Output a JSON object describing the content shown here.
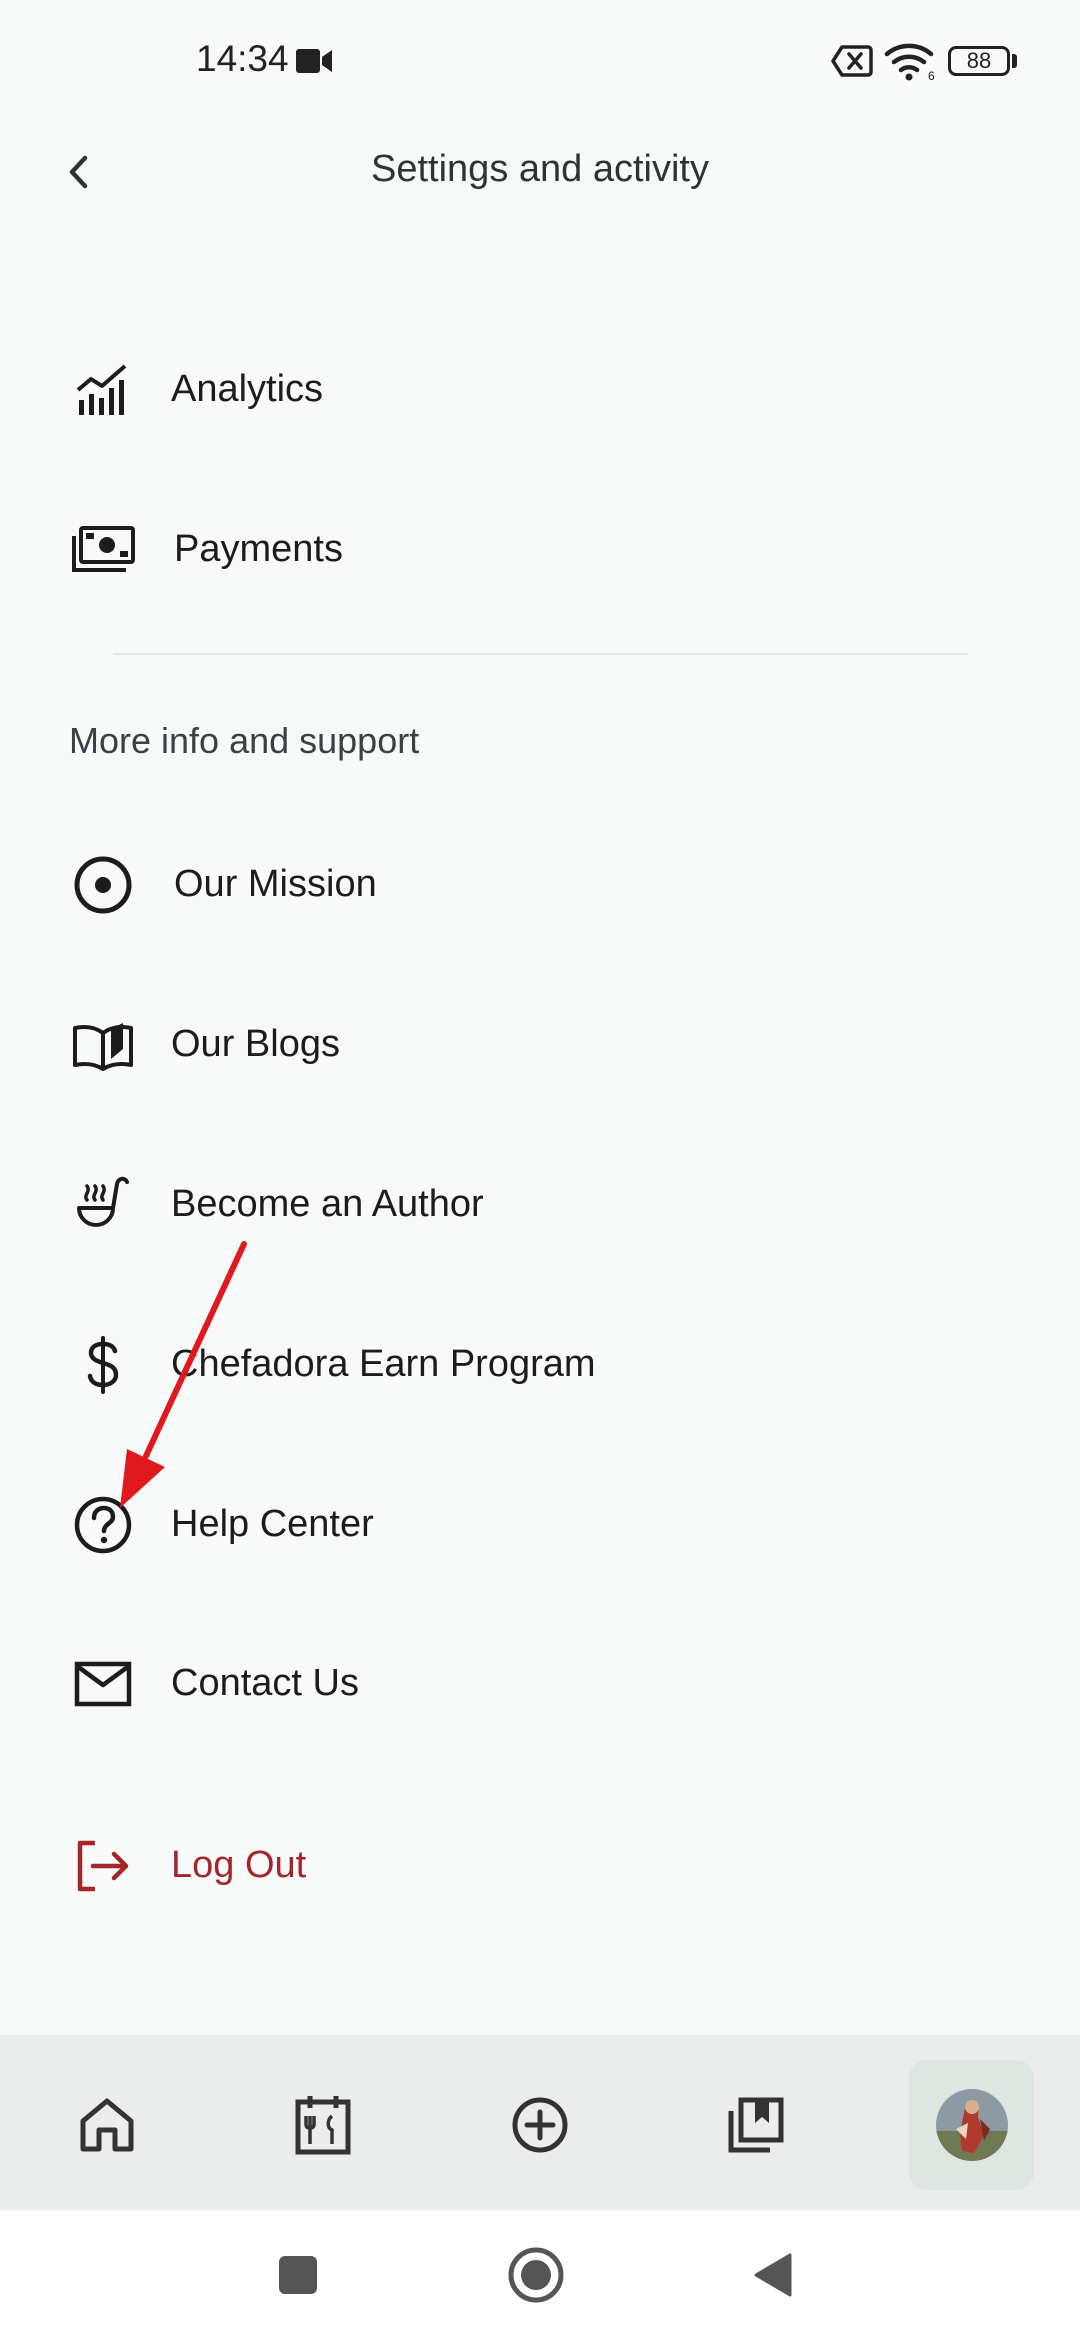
{
  "status_bar": {
    "time": "14:34",
    "battery": "88",
    "icons": [
      "video-camera-icon",
      "sim-off-icon",
      "wifi-icon",
      "battery-icon"
    ]
  },
  "header": {
    "title": "Settings and activity",
    "back_icon": "chevron-left-icon"
  },
  "menu": {
    "items": [
      {
        "label": "Analytics",
        "icon": "analytics-chart-icon"
      },
      {
        "label": "Payments",
        "icon": "money-icon"
      }
    ]
  },
  "support": {
    "section_title": "More info and support",
    "items": [
      {
        "label": "Our Mission",
        "icon": "target-icon"
      },
      {
        "label": "Our Blogs",
        "icon": "open-book-icon"
      },
      {
        "label": "Become an Author",
        "icon": "soup-ladle-icon"
      },
      {
        "label": "Chefadora Earn Program",
        "icon": "dollar-icon"
      },
      {
        "label": "Help Center",
        "icon": "help-circle-icon"
      },
      {
        "label": "Contact Us",
        "icon": "mail-icon"
      }
    ]
  },
  "logout": {
    "label": "Log Out",
    "icon": "logout-icon",
    "color": "#a3262a"
  },
  "annotation": {
    "color": "#e0191f",
    "points_to": "Help Center"
  },
  "bottom_nav": {
    "items": [
      "home-icon",
      "meal-plan-calendar-icon",
      "add-circle-icon",
      "saved-collection-icon",
      "profile-avatar"
    ],
    "active": "profile-avatar"
  },
  "system_nav": {
    "items": [
      "recents-square-icon",
      "home-circle-icon",
      "back-triangle-icon"
    ]
  }
}
